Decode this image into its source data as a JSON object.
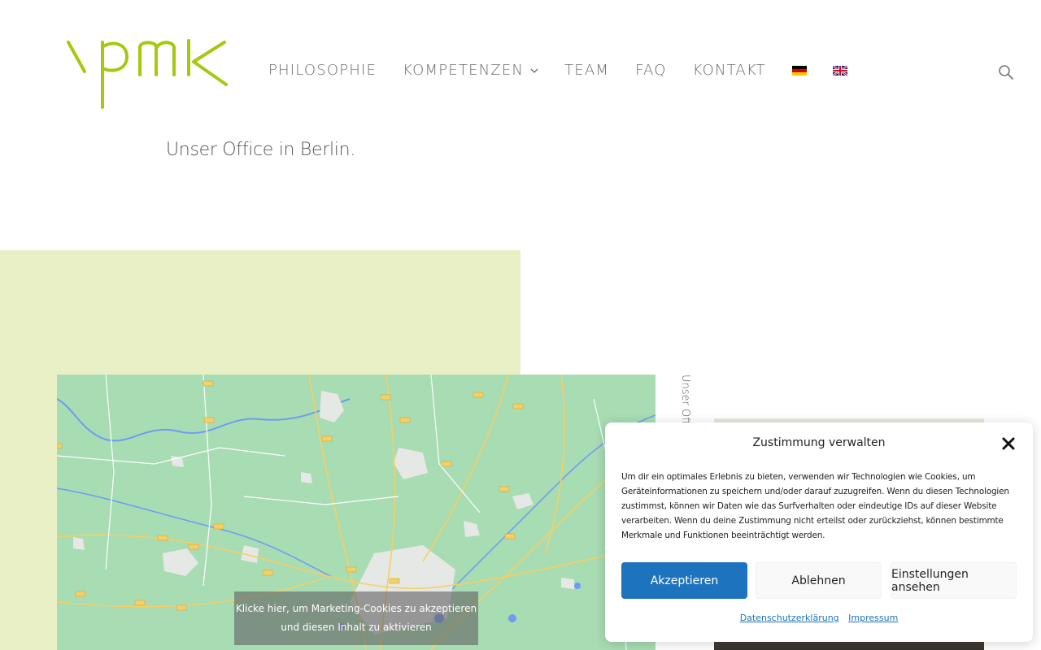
{
  "header": {
    "logo_text": "vpmk",
    "logo_color": "#a4c90f",
    "nav": [
      {
        "label": "PHILOSOPHIE"
      },
      {
        "label": "KOMPETENZEN",
        "has_dropdown": true
      },
      {
        "label": "TEAM"
      },
      {
        "label": "FAQ"
      },
      {
        "label": "KONTAKT"
      }
    ],
    "flags": [
      "german-flag-icon",
      "uk-flag-icon"
    ],
    "search_icon": "search-icon"
  },
  "main": {
    "subtitle": "Unser Office in Berlin.",
    "vertical_caption": "Unser Office",
    "map_overlay": {
      "line1": "Klicke hier, um Marketing-Cookies zu akzeptieren",
      "line2": "und diesen Inhalt zu aktivieren"
    }
  },
  "cookie_dialog": {
    "title": "Zustimmung verwalten",
    "text": "Um dir ein optimales Erlebnis zu bieten, verwenden wir Technologien wie Cookies, um Geräteinformationen zu speichern und/oder darauf zuzugreifen. Wenn du diesen Technologien zustimmst, können wir Daten wie das Surfverhalten oder eindeutige IDs auf dieser Website verarbeiten. Wenn du deine Zustimmung nicht erteilst oder zurückziehst, können bestimmte Merkmale und Funktionen beeinträchtigt werden.",
    "buttons": {
      "accept": "Akzeptieren",
      "deny": "Ablehnen",
      "preferences": "Einstellungen ansehen"
    },
    "links": {
      "privacy": "Datenschutzerklärung",
      "imprint": "Impressum"
    },
    "accent_color": "#1e73be"
  },
  "colors": {
    "green_block": "#e9f0c6",
    "map_land": "#a8dcb3"
  }
}
